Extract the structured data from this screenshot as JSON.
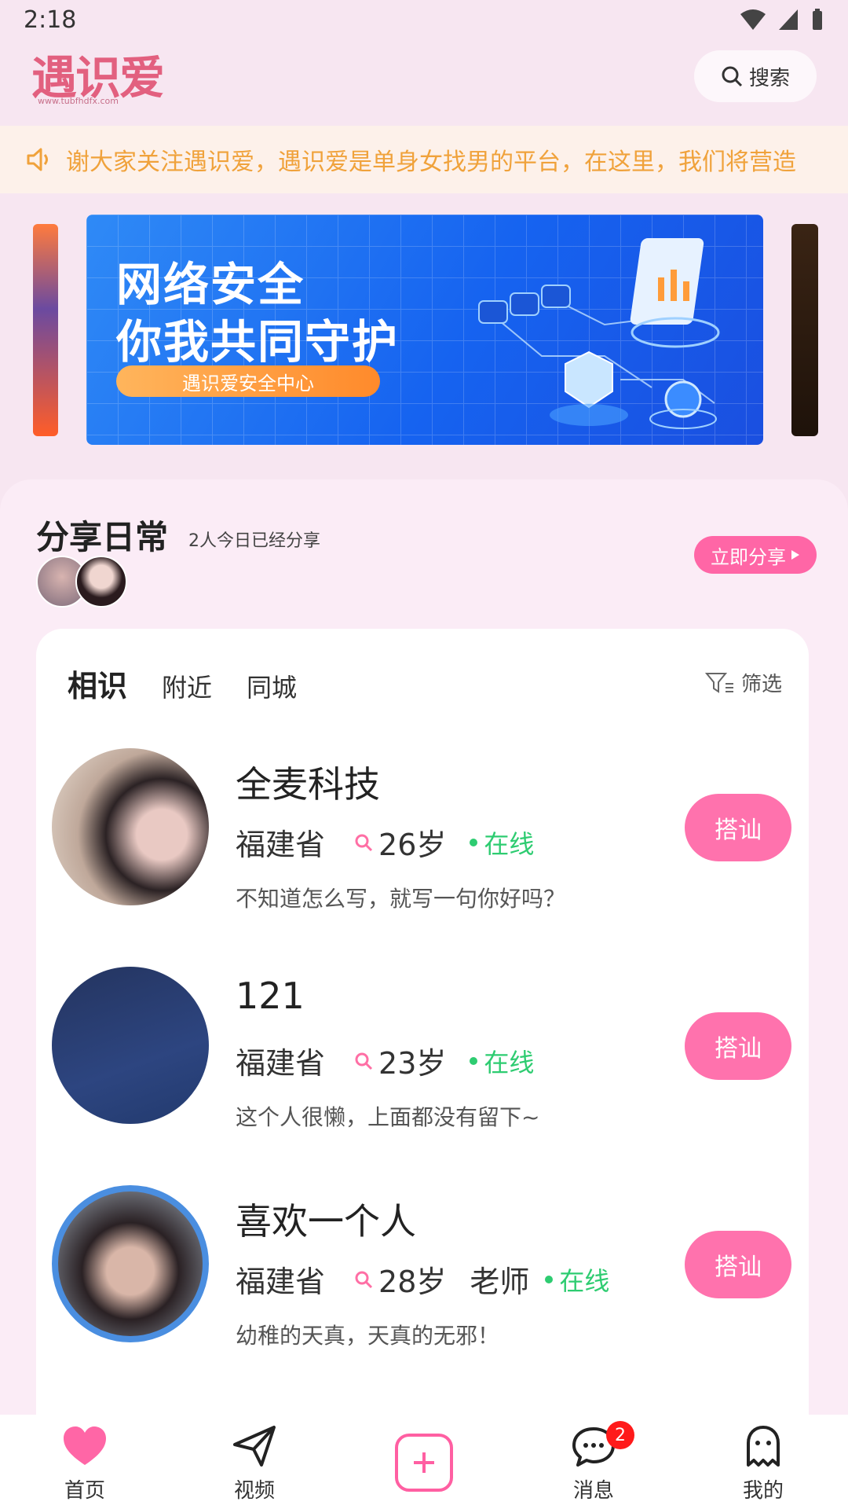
{
  "status_bar": {
    "time": "2:18"
  },
  "header": {
    "logo_text": "遇识爱",
    "logo_sub": "www.tubfhdfx.com",
    "search_label": "搜索"
  },
  "notice": {
    "text": "谢大家关注遇识爱，遇识爱是单身女找男的平台，在这里，我们将营造"
  },
  "banner": {
    "title_line1": "网络安全",
    "title_line2": "你我共同守护",
    "pill_label": "遇识爱安全中心"
  },
  "share": {
    "title": "分享日常",
    "count_text": "2人今日已经分享",
    "button_label": "立即分享"
  },
  "tabs": [
    {
      "label": "相识",
      "active": true
    },
    {
      "label": "附近",
      "active": false
    },
    {
      "label": "同城",
      "active": false
    }
  ],
  "filter_label": "筛选",
  "users": [
    {
      "name": "全麦科技",
      "province": "福建省",
      "age": "26岁",
      "job": "",
      "online": "在线",
      "bio": "不知道怎么写，就写一句你好吗？",
      "button": "搭讪"
    },
    {
      "name": "121",
      "province": "福建省",
      "age": "23岁",
      "job": "",
      "online": "在线",
      "bio": "这个人很懒，上面都没有留下~",
      "button": "搭讪"
    },
    {
      "name": "喜欢一个人",
      "province": "福建省",
      "age": "28岁",
      "job": "老师",
      "online": "在线",
      "bio": "幼稚的天真，天真的无邪！",
      "button": "搭讪"
    }
  ],
  "bottom_nav": {
    "home": "首页",
    "video": "视频",
    "messages": "消息",
    "messages_badge": "2",
    "me": "我的"
  },
  "colors": {
    "accent": "#ff66a6",
    "online": "#2ecc71",
    "notice": "#f0a23b"
  }
}
